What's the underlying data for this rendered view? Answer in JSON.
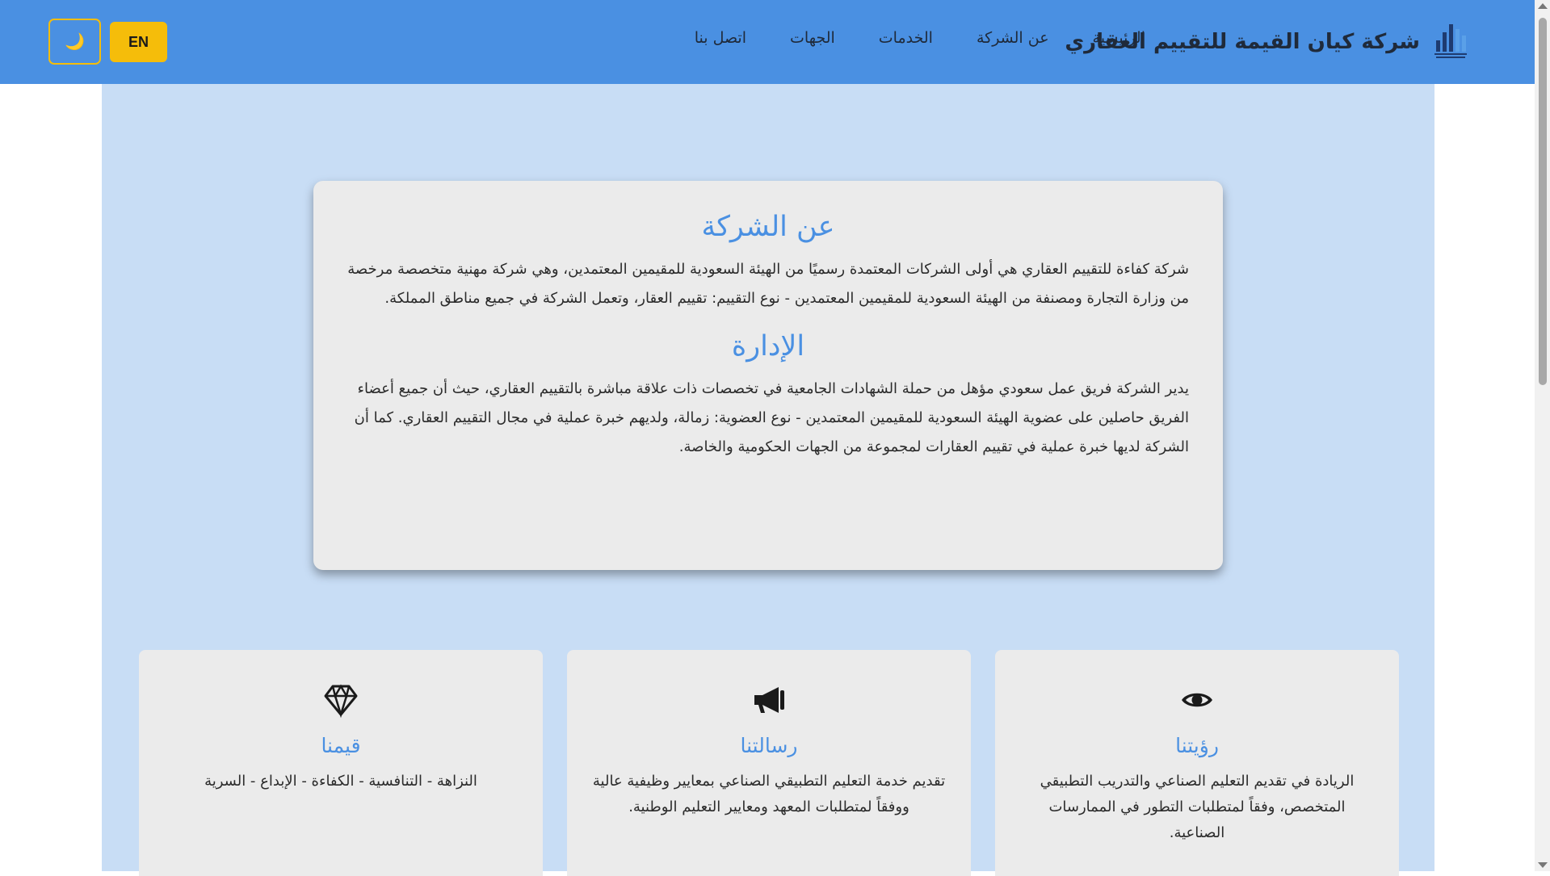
{
  "header": {
    "brand_name": "شركة كيان القيمة للتقييم العقاري",
    "nav": [
      {
        "label": "الرئيسية"
      },
      {
        "label": "عن الشركة"
      },
      {
        "label": "الخدمات"
      },
      {
        "label": "الجهات"
      },
      {
        "label": "اتصل بنا"
      }
    ],
    "lang_button": "EN",
    "theme_icon": "moon-icon",
    "theme_glyph": "🌙"
  },
  "about": {
    "title": "عن الشركة",
    "text": "شركة كفاءة للتقييم العقاري هي أولى الشركات المعتمدة رسميًا من الهيئة السعودية للمقيمين المعتمدين، وهي شركة مهنية متخصصة مرخصة من وزارة التجارة ومصنفة من الهيئة السعودية للمقيمين المعتمدين - نوع التقييم: تقييم العقار، وتعمل الشركة في جميع مناطق المملكة.",
    "management_title": "الإدارة",
    "management_text": "يدير الشركة فريق عمل سعودي مؤهل من حملة الشهادات الجامعية في تخصصات ذات علاقة مباشرة بالتقييم العقاري، حيث أن جميع أعضاء الفريق حاصلين على عضوية الهيئة السعودية للمقيمين المعتمدين - نوع العضوية: زمالة، ولديهم خبرة عملية في مجال التقييم العقاري. كما أن الشركة لديها خبرة عملية في تقييم العقارات لمجموعة من الجهات الحكومية والخاصة."
  },
  "cards": {
    "vision": {
      "icon": "eye-icon",
      "title": "رؤيتنا",
      "text": "الريادة في تقديم التعليم الصناعي والتدريب التطبيقي المتخصص، وفقاً لمتطلبات التطور في الممارسات الصناعية."
    },
    "mission": {
      "icon": "megaphone-icon",
      "title": "رسالتنا",
      "text": "تقديم خدمة التعليم التطبيقي الصناعي بمعايير وظيفية عالية ووفقاً لمتطلبات المعهد ومعايير التعليم الوطنية."
    },
    "values": {
      "icon": "diamond-icon",
      "title": "قيمنا",
      "text": "النزاهة - التنافسية - الكفاءة - الإبداع - السرية"
    }
  },
  "colors": {
    "header_bg": "#4a90e2",
    "accent": "#4a90e2",
    "button_yellow": "#f5bd0a",
    "page_bg": "#c8ddf5",
    "card_bg": "#ebebeb"
  }
}
